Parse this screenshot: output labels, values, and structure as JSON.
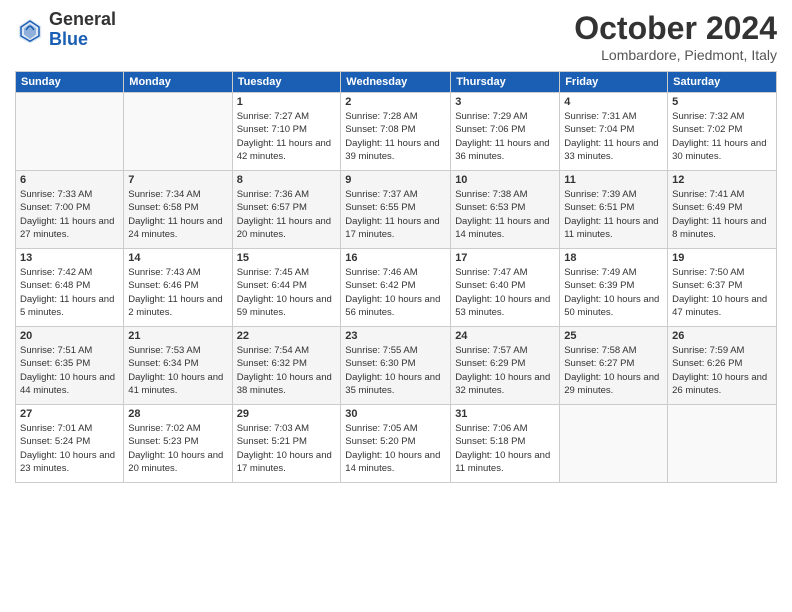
{
  "header": {
    "logo_general": "General",
    "logo_blue": "Blue",
    "month_title": "October 2024",
    "location": "Lombardore, Piedmont, Italy"
  },
  "days_of_week": [
    "Sunday",
    "Monday",
    "Tuesday",
    "Wednesday",
    "Thursday",
    "Friday",
    "Saturday"
  ],
  "weeks": [
    [
      {
        "day": "",
        "info": ""
      },
      {
        "day": "",
        "info": ""
      },
      {
        "day": "1",
        "info": "Sunrise: 7:27 AM\nSunset: 7:10 PM\nDaylight: 11 hours and 42 minutes."
      },
      {
        "day": "2",
        "info": "Sunrise: 7:28 AM\nSunset: 7:08 PM\nDaylight: 11 hours and 39 minutes."
      },
      {
        "day": "3",
        "info": "Sunrise: 7:29 AM\nSunset: 7:06 PM\nDaylight: 11 hours and 36 minutes."
      },
      {
        "day": "4",
        "info": "Sunrise: 7:31 AM\nSunset: 7:04 PM\nDaylight: 11 hours and 33 minutes."
      },
      {
        "day": "5",
        "info": "Sunrise: 7:32 AM\nSunset: 7:02 PM\nDaylight: 11 hours and 30 minutes."
      }
    ],
    [
      {
        "day": "6",
        "info": "Sunrise: 7:33 AM\nSunset: 7:00 PM\nDaylight: 11 hours and 27 minutes."
      },
      {
        "day": "7",
        "info": "Sunrise: 7:34 AM\nSunset: 6:58 PM\nDaylight: 11 hours and 24 minutes."
      },
      {
        "day": "8",
        "info": "Sunrise: 7:36 AM\nSunset: 6:57 PM\nDaylight: 11 hours and 20 minutes."
      },
      {
        "day": "9",
        "info": "Sunrise: 7:37 AM\nSunset: 6:55 PM\nDaylight: 11 hours and 17 minutes."
      },
      {
        "day": "10",
        "info": "Sunrise: 7:38 AM\nSunset: 6:53 PM\nDaylight: 11 hours and 14 minutes."
      },
      {
        "day": "11",
        "info": "Sunrise: 7:39 AM\nSunset: 6:51 PM\nDaylight: 11 hours and 11 minutes."
      },
      {
        "day": "12",
        "info": "Sunrise: 7:41 AM\nSunset: 6:49 PM\nDaylight: 11 hours and 8 minutes."
      }
    ],
    [
      {
        "day": "13",
        "info": "Sunrise: 7:42 AM\nSunset: 6:48 PM\nDaylight: 11 hours and 5 minutes."
      },
      {
        "day": "14",
        "info": "Sunrise: 7:43 AM\nSunset: 6:46 PM\nDaylight: 11 hours and 2 minutes."
      },
      {
        "day": "15",
        "info": "Sunrise: 7:45 AM\nSunset: 6:44 PM\nDaylight: 10 hours and 59 minutes."
      },
      {
        "day": "16",
        "info": "Sunrise: 7:46 AM\nSunset: 6:42 PM\nDaylight: 10 hours and 56 minutes."
      },
      {
        "day": "17",
        "info": "Sunrise: 7:47 AM\nSunset: 6:40 PM\nDaylight: 10 hours and 53 minutes."
      },
      {
        "day": "18",
        "info": "Sunrise: 7:49 AM\nSunset: 6:39 PM\nDaylight: 10 hours and 50 minutes."
      },
      {
        "day": "19",
        "info": "Sunrise: 7:50 AM\nSunset: 6:37 PM\nDaylight: 10 hours and 47 minutes."
      }
    ],
    [
      {
        "day": "20",
        "info": "Sunrise: 7:51 AM\nSunset: 6:35 PM\nDaylight: 10 hours and 44 minutes."
      },
      {
        "day": "21",
        "info": "Sunrise: 7:53 AM\nSunset: 6:34 PM\nDaylight: 10 hours and 41 minutes."
      },
      {
        "day": "22",
        "info": "Sunrise: 7:54 AM\nSunset: 6:32 PM\nDaylight: 10 hours and 38 minutes."
      },
      {
        "day": "23",
        "info": "Sunrise: 7:55 AM\nSunset: 6:30 PM\nDaylight: 10 hours and 35 minutes."
      },
      {
        "day": "24",
        "info": "Sunrise: 7:57 AM\nSunset: 6:29 PM\nDaylight: 10 hours and 32 minutes."
      },
      {
        "day": "25",
        "info": "Sunrise: 7:58 AM\nSunset: 6:27 PM\nDaylight: 10 hours and 29 minutes."
      },
      {
        "day": "26",
        "info": "Sunrise: 7:59 AM\nSunset: 6:26 PM\nDaylight: 10 hours and 26 minutes."
      }
    ],
    [
      {
        "day": "27",
        "info": "Sunrise: 7:01 AM\nSunset: 5:24 PM\nDaylight: 10 hours and 23 minutes."
      },
      {
        "day": "28",
        "info": "Sunrise: 7:02 AM\nSunset: 5:23 PM\nDaylight: 10 hours and 20 minutes."
      },
      {
        "day": "29",
        "info": "Sunrise: 7:03 AM\nSunset: 5:21 PM\nDaylight: 10 hours and 17 minutes."
      },
      {
        "day": "30",
        "info": "Sunrise: 7:05 AM\nSunset: 5:20 PM\nDaylight: 10 hours and 14 minutes."
      },
      {
        "day": "31",
        "info": "Sunrise: 7:06 AM\nSunset: 5:18 PM\nDaylight: 10 hours and 11 minutes."
      },
      {
        "day": "",
        "info": ""
      },
      {
        "day": "",
        "info": ""
      }
    ]
  ]
}
